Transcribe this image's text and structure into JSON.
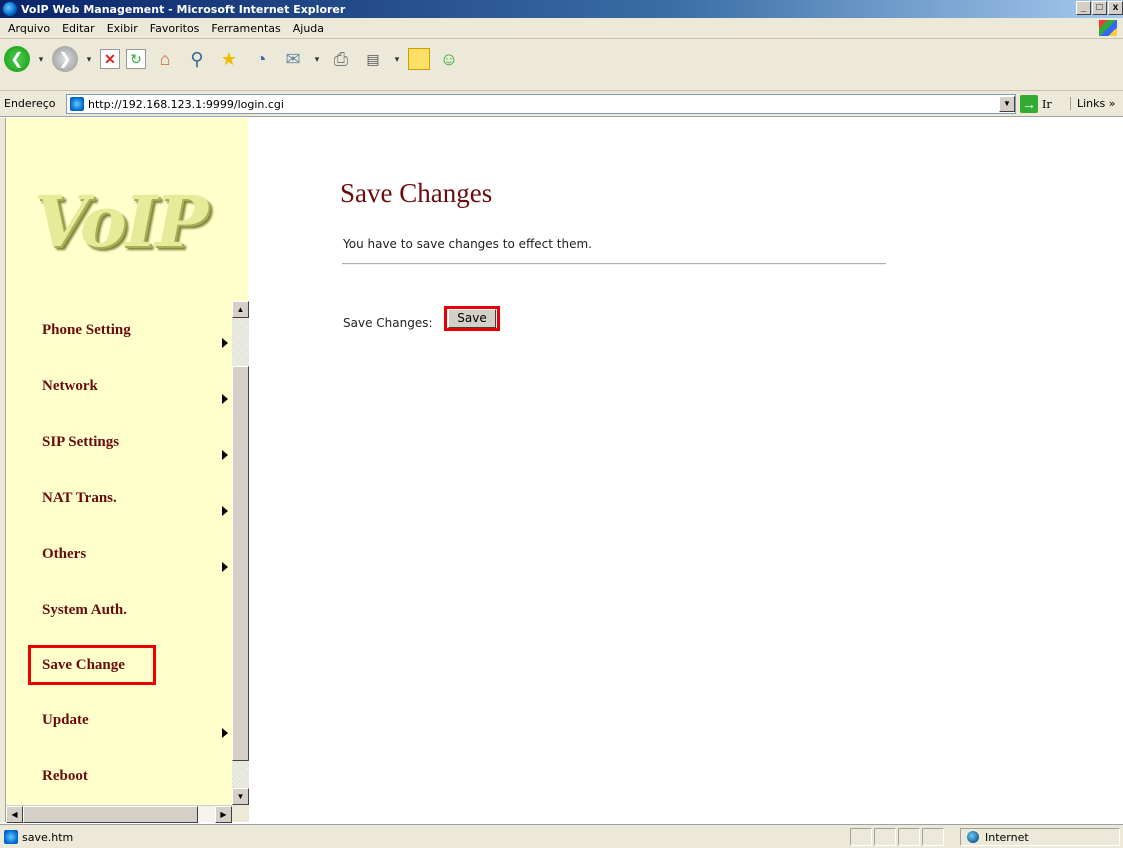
{
  "window": {
    "title": "VoIP Web Management - Microsoft Internet Explorer",
    "controls": {
      "minimize": "_",
      "maximize": "□",
      "close": "x"
    }
  },
  "menu": {
    "items": [
      "Arquivo",
      "Editar",
      "Exibir",
      "Favoritos",
      "Ferramentas",
      "Ajuda"
    ]
  },
  "toolbar": {
    "icons": [
      "back-icon",
      "forward-icon",
      "stop-icon",
      "refresh-icon",
      "home-icon",
      "search-icon",
      "favorites-icon",
      "history-icon",
      "mail-icon",
      "print-icon",
      "edit-icon",
      "notes-icon",
      "messenger-icon"
    ]
  },
  "address": {
    "label": "Endereço",
    "url": "http://192.168.123.1:9999/login.cgi",
    "go_label": "Ir",
    "links_label": "Links »"
  },
  "sidebar": {
    "logo_text": "VoIP",
    "items": [
      {
        "label": "Phone Setting",
        "has_submenu": true
      },
      {
        "label": "Network",
        "has_submenu": true
      },
      {
        "label": "SIP Settings",
        "has_submenu": true
      },
      {
        "label": "NAT Trans.",
        "has_submenu": true
      },
      {
        "label": "Others",
        "has_submenu": true
      },
      {
        "label": "System Auth.",
        "has_submenu": false
      },
      {
        "label": "Save Change",
        "has_submenu": false,
        "highlighted": true
      },
      {
        "label": "Update",
        "has_submenu": true
      },
      {
        "label": "Reboot",
        "has_submenu": false
      }
    ]
  },
  "main": {
    "title": "Save Changes",
    "description": "You have to save changes to effect them.",
    "save_label": "Save Changes:",
    "save_button": "Save"
  },
  "status": {
    "text": "save.htm",
    "zone": "Internet"
  },
  "colors": {
    "nav_text": "#6b0c0c",
    "sidebar_bg": "#ffffcc",
    "highlight": "#e00000"
  }
}
